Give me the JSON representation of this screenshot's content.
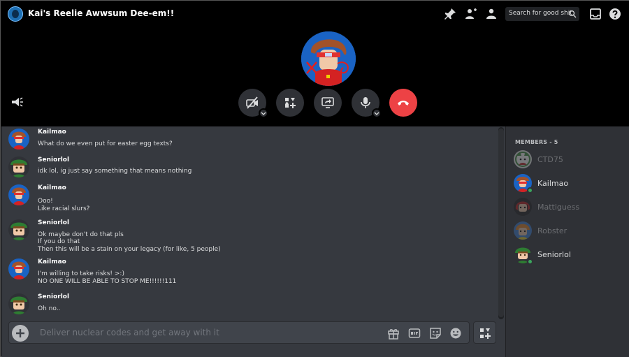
{
  "header": {
    "server_name": "Kai's Reelie Awwsum Dee-em!!",
    "search_placeholder": "Search for good shit"
  },
  "call": {
    "controls": [
      "camera-off",
      "activity",
      "screen-share",
      "microphone",
      "disconnect"
    ]
  },
  "messages": [
    {
      "author": "Kailmao",
      "lines": [
        "What do we even put for easter egg texts?"
      ]
    },
    {
      "author": "Seniorlol",
      "lines": [
        "idk lol, ig just say something that means nothing"
      ]
    },
    {
      "author": "Kailmao",
      "lines": [
        "Ooo!",
        "Like racial slurs?"
      ]
    },
    {
      "author": "Seniorlol",
      "lines": [
        "Ok maybe don't do that pls",
        "If you do that",
        "Then this will be a stain on your legacy (for like, 5 people)"
      ]
    },
    {
      "author": "Kailmao",
      "lines": [
        "I'm willing to take risks! >:)",
        "NO ONE WILL BE ABLE TO STOP ME!!!!!!111"
      ]
    },
    {
      "author": "Seniorlol",
      "lines": [
        "Oh no.."
      ]
    }
  ],
  "composer": {
    "placeholder": "Deliver nuclear codes and get away with it"
  },
  "members": {
    "heading": "MEMBERS - 5",
    "list": [
      {
        "name": "CTD75",
        "status": "offline"
      },
      {
        "name": "Kailmao",
        "status": "online"
      },
      {
        "name": "Mattiguess",
        "status": "offline"
      },
      {
        "name": "Robster",
        "status": "offline"
      },
      {
        "name": "Seniorlol",
        "status": "online"
      }
    ]
  },
  "colors": {
    "accent_red": "#ed4245",
    "online": "#3ba55d",
    "chat_bg": "#36393f",
    "panel_bg": "#2f3136"
  }
}
